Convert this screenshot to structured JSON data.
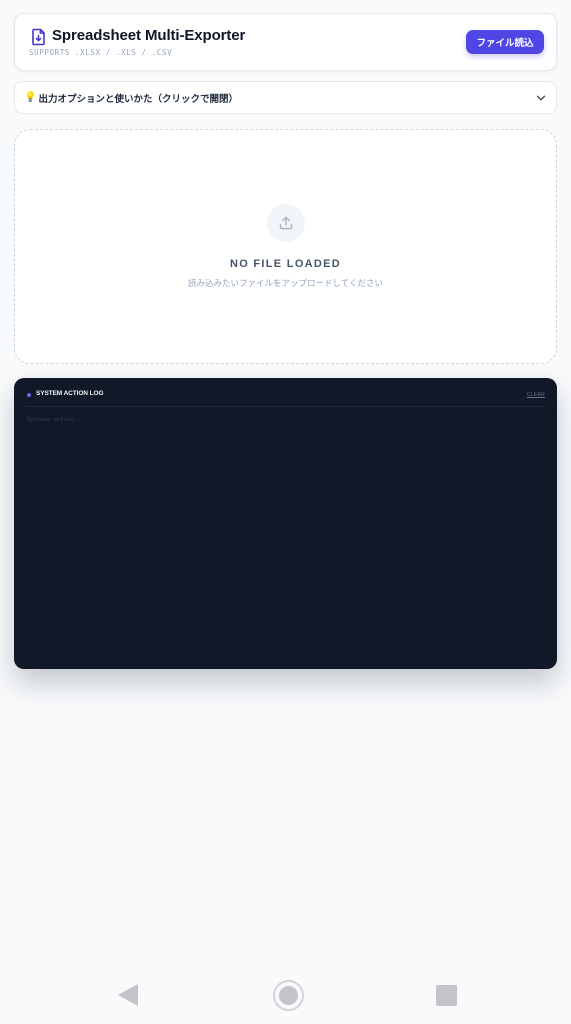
{
  "header": {
    "title": "Spreadsheet Multi-Exporter",
    "subtitle": "SUPPORTS .XLSX / .XLS / .CSV",
    "import_button_label": "ファイル読込",
    "icon": "file-download-icon",
    "accent_color": "#4f46e5"
  },
  "help": {
    "icon": "lightbulb-icon",
    "label": "出力オプションと使いかた（クリックで開閉）",
    "toggle_icon": "chevron-down-icon"
  },
  "upload": {
    "icon": "upload-icon",
    "empty_title": "NO FILE LOADED",
    "empty_description": "読み込みたいファイルをアップロードしてください"
  },
  "log": {
    "title": "SYSTEM ACTION LOG",
    "clear_label": "CLEAR",
    "lines": [
      "Systems active..."
    ],
    "background_color": "#111827"
  },
  "navbar": {
    "back_icon": "back-triangle-icon",
    "home_icon": "home-circle-icon",
    "recents_icon": "recents-square-icon"
  }
}
